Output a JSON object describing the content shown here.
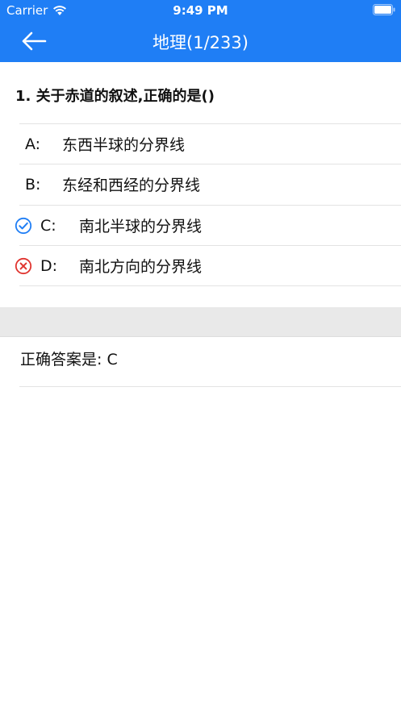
{
  "status_bar": {
    "carrier": "Carrier",
    "time": "9:49 PM"
  },
  "nav": {
    "title": "地理(1/233)",
    "back_icon": "arrow-left-icon"
  },
  "question": {
    "text": "1.  关于赤道的叙述,正确的是()"
  },
  "options": [
    {
      "letter": "A:",
      "text": "东西半球的分界线",
      "mark": ""
    },
    {
      "letter": "B:",
      "text": "东经和西经的分界线",
      "mark": ""
    },
    {
      "letter": "C:",
      "text": "南北半球的分界线",
      "mark": "check-circle-icon"
    },
    {
      "letter": "D:",
      "text": "南北方向的分界线",
      "mark": "cross-circle-icon"
    }
  ],
  "answer": {
    "text": "正确答案是: C"
  },
  "colors": {
    "header": "#1f7ef5",
    "correct": "#1f7ef5",
    "wrong": "#e0342f"
  }
}
